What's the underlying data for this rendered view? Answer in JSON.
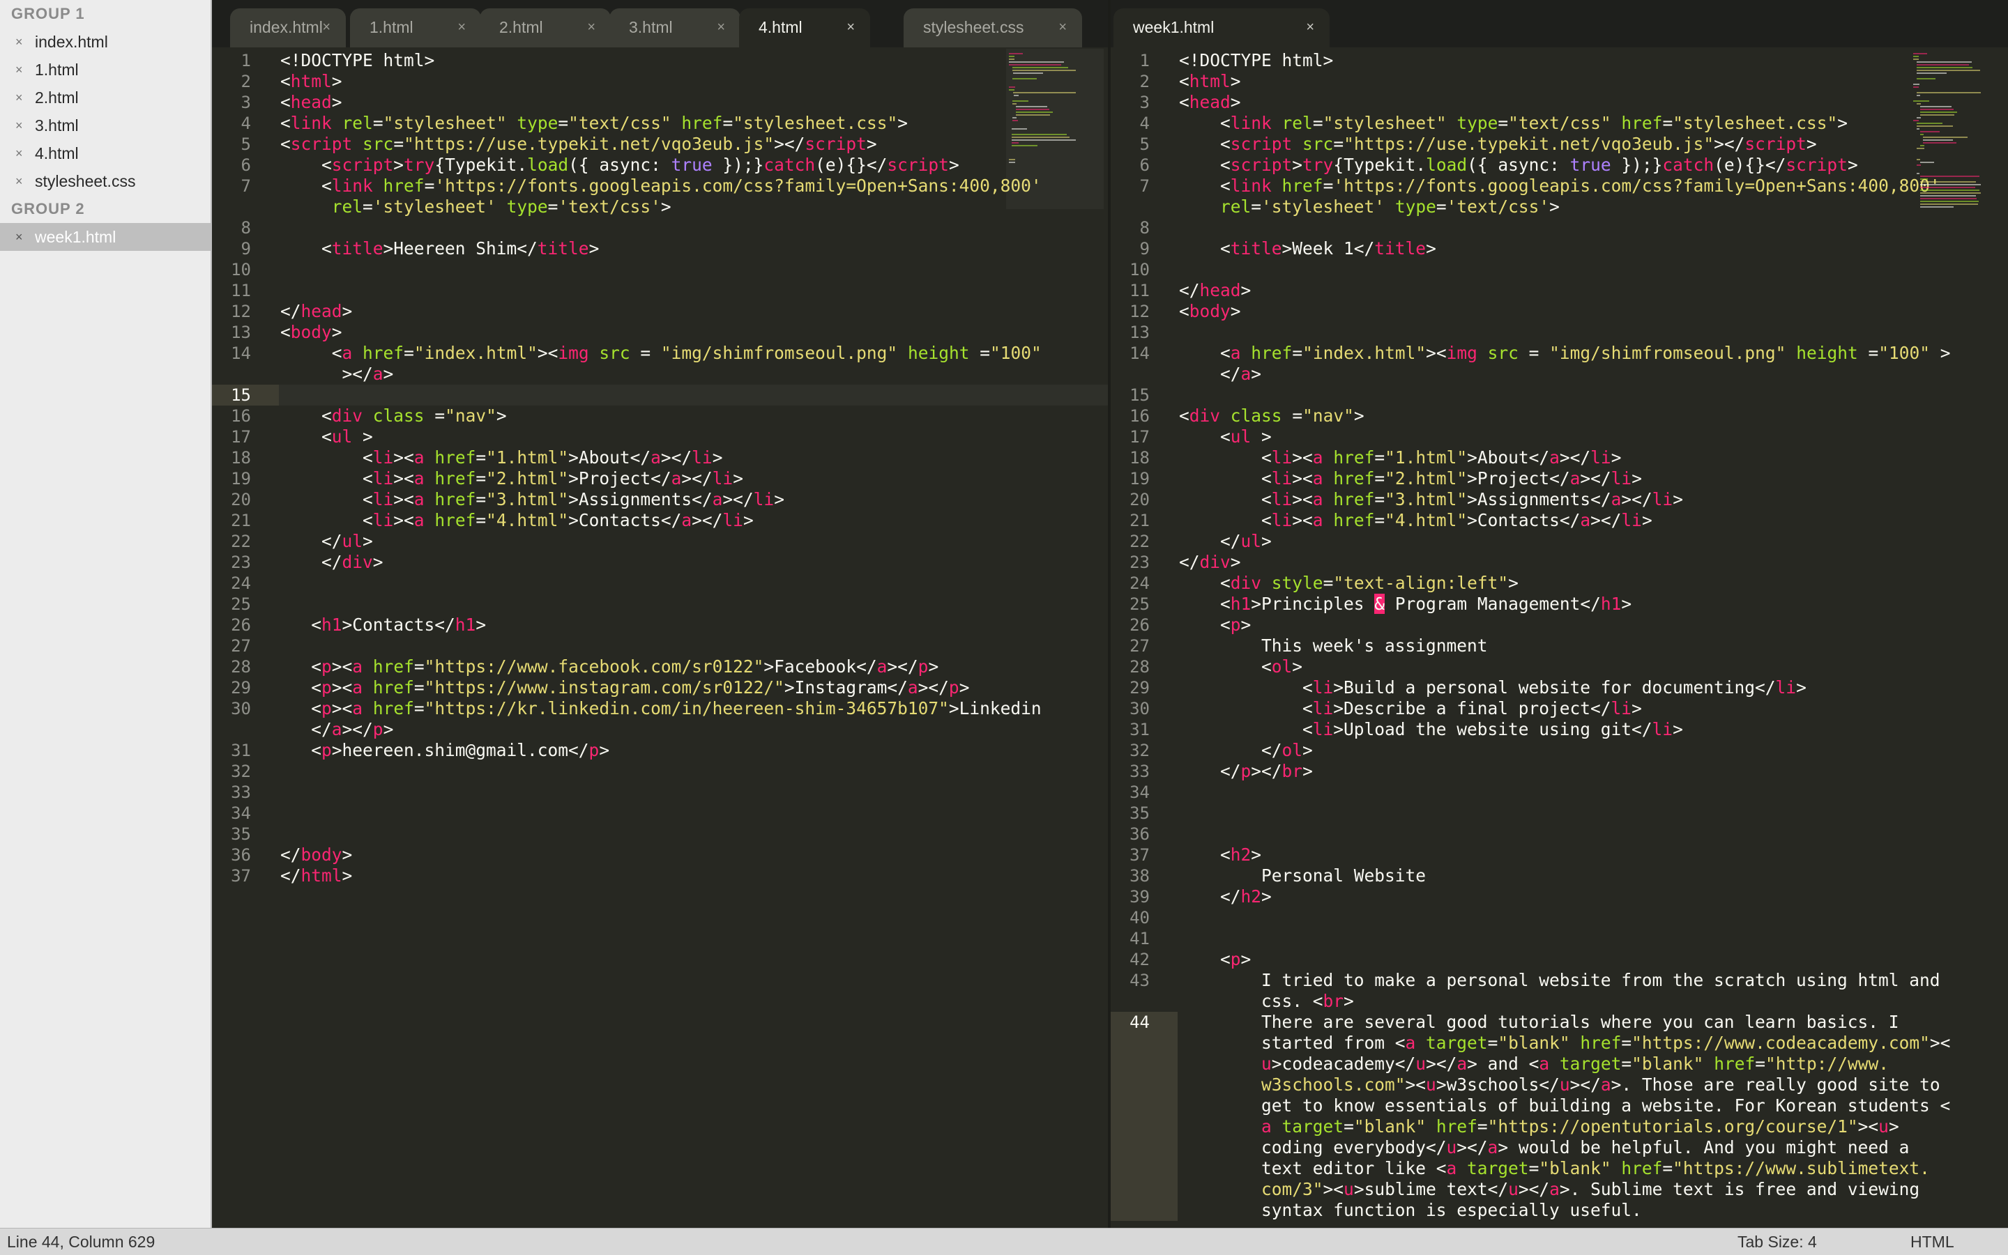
{
  "sidebar": {
    "groups": [
      {
        "title": "GROUP 1",
        "files": [
          "index.html",
          "1.html",
          "2.html",
          "3.html",
          "4.html",
          "stylesheet.css"
        ]
      },
      {
        "title": "GROUP 2",
        "files": [
          "week1.html"
        ]
      }
    ],
    "active_file": "week1.html",
    "close_glyph": "×"
  },
  "left_pane": {
    "tabs": [
      "index.html",
      "1.html",
      "2.html",
      "3.html",
      "4.html",
      "stylesheet.css"
    ],
    "active_tab": "4.html",
    "current_line": "15",
    "lines": [
      {
        "n": "1",
        "html": "&lt;!DOCTYPE html&gt;"
      },
      {
        "n": "2",
        "html": "&lt;<span class='t'>html</span>&gt;"
      },
      {
        "n": "3",
        "html": "&lt;<span class='t'>head</span>&gt;"
      },
      {
        "n": "4",
        "html": "&lt;<span class='t'>link</span> <span class='a'>rel</span>=<span class='s'>\"stylesheet\"</span> <span class='a'>type</span>=<span class='s'>\"text/css\"</span> <span class='a'>href</span>=<span class='s'>\"stylesheet.css\"</span>&gt;"
      },
      {
        "n": "5",
        "html": "&lt;<span class='t'>script</span> <span class='a'>src</span>=<span class='s'>\"https://use.typekit.net/vqo3eub.js\"</span>&gt;&lt;/<span class='t'>script</span>&gt;"
      },
      {
        "n": "6",
        "html": "    &lt;<span class='t'>script</span>&gt;<span class='t'>try</span>{Typekit.<span class='a'>load</span>({ async: <span class='kw'>true</span> });}<span class='t'>catch</span>(e){}&lt;/<span class='t'>script</span>&gt;"
      },
      {
        "n": "7",
        "html": "    &lt;<span class='t'>link</span> <span class='a'>href</span>=<span class='s'>'https://fonts.googleapis.com/css?family=Open+Sans:400,800'</span>"
      },
      {
        "n": "",
        "html": "     <span class='a'>rel</span>=<span class='s'>'stylesheet'</span> <span class='a'>type</span>=<span class='s'>'text/css'</span>&gt;"
      },
      {
        "n": "8",
        "html": ""
      },
      {
        "n": "9",
        "html": "    &lt;<span class='t'>title</span>&gt;Heereen Shim&lt;/<span class='t'>title</span>&gt;"
      },
      {
        "n": "10",
        "html": ""
      },
      {
        "n": "11",
        "html": ""
      },
      {
        "n": "12",
        "html": "&lt;/<span class='t'>head</span>&gt;"
      },
      {
        "n": "13",
        "html": "&lt;<span class='t'>body</span>&gt;"
      },
      {
        "n": "14",
        "html": "     &lt;<span class='t'>a</span> <span class='a'>href</span>=<span class='s'>\"index.html\"</span>&gt;&lt;<span class='t'>img</span> <span class='a'>src</span> = <span class='s'>\"img/shimfromseoul.png\"</span> <span class='a'>height</span> =<span class='s'>\"100\"</span>"
      },
      {
        "n": "",
        "html": "      &gt;&lt;/<span class='t'>a</span>&gt;"
      },
      {
        "n": "15",
        "html": ""
      },
      {
        "n": "16",
        "html": "    &lt;<span class='t'>div</span> <span class='a'>class</span> =<span class='s'>\"nav\"</span>&gt;"
      },
      {
        "n": "17",
        "html": "    &lt;<span class='t'>ul</span> &gt;"
      },
      {
        "n": "18",
        "html": "        &lt;<span class='t'>li</span>&gt;&lt;<span class='t'>a</span> <span class='a'>href</span>=<span class='s'>\"1.html\"</span>&gt;About&lt;/<span class='t'>a</span>&gt;&lt;/<span class='t'>li</span>&gt;"
      },
      {
        "n": "19",
        "html": "        &lt;<span class='t'>li</span>&gt;&lt;<span class='t'>a</span> <span class='a'>href</span>=<span class='s'>\"2.html\"</span>&gt;Project&lt;/<span class='t'>a</span>&gt;&lt;/<span class='t'>li</span>&gt;"
      },
      {
        "n": "20",
        "html": "        &lt;<span class='t'>li</span>&gt;&lt;<span class='t'>a</span> <span class='a'>href</span>=<span class='s'>\"3.html\"</span>&gt;Assignments&lt;/<span class='t'>a</span>&gt;&lt;/<span class='t'>li</span>&gt;"
      },
      {
        "n": "21",
        "html": "        &lt;<span class='t'>li</span>&gt;&lt;<span class='t'>a</span> <span class='a'>href</span>=<span class='s'>\"4.html\"</span>&gt;Contacts&lt;/<span class='t'>a</span>&gt;&lt;/<span class='t'>li</span>&gt;"
      },
      {
        "n": "22",
        "html": "    &lt;/<span class='t'>ul</span>&gt;"
      },
      {
        "n": "23",
        "html": "    &lt;/<span class='t'>div</span>&gt;"
      },
      {
        "n": "24",
        "html": ""
      },
      {
        "n": "25",
        "html": ""
      },
      {
        "n": "26",
        "html": "   &lt;<span class='t'>h1</span>&gt;Contacts&lt;/<span class='t'>h1</span>&gt;"
      },
      {
        "n": "27",
        "html": ""
      },
      {
        "n": "28",
        "html": "   &lt;<span class='t'>p</span>&gt;&lt;<span class='t'>a</span> <span class='a'>href</span>=<span class='s'>\"https://www.facebook.com/sr0122\"</span>&gt;Facebook&lt;/<span class='t'>a</span>&gt;&lt;/<span class='t'>p</span>&gt;"
      },
      {
        "n": "29",
        "html": "   &lt;<span class='t'>p</span>&gt;&lt;<span class='t'>a</span> <span class='a'>href</span>=<span class='s'>\"https://www.instagram.com/sr0122/\"</span>&gt;Instagram&lt;/<span class='t'>a</span>&gt;&lt;/<span class='t'>p</span>&gt;"
      },
      {
        "n": "30",
        "html": "   &lt;<span class='t'>p</span>&gt;&lt;<span class='t'>a</span> <span class='a'>href</span>=<span class='s'>\"https://kr.linkedin.com/in/heereen-shim-34657b107\"</span>&gt;Linkedin"
      },
      {
        "n": "",
        "html": "   &lt;/<span class='t'>a</span>&gt;&lt;/<span class='t'>p</span>&gt;"
      },
      {
        "n": "31",
        "html": "   &lt;<span class='t'>p</span>&gt;heereen.shim@gmail.com&lt;/<span class='t'>p</span>&gt;"
      },
      {
        "n": "32",
        "html": ""
      },
      {
        "n": "33",
        "html": ""
      },
      {
        "n": "34",
        "html": ""
      },
      {
        "n": "35",
        "html": ""
      },
      {
        "n": "36",
        "html": "&lt;/<span class='t'>body</span>&gt;"
      },
      {
        "n": "37",
        "html": "&lt;/<span class='t'>html</span>&gt;"
      }
    ]
  },
  "right_pane": {
    "tabs": [
      "week1.html"
    ],
    "active_tab": "week1.html",
    "current_line": "44",
    "lines": [
      {
        "n": "1",
        "html": "&lt;!DOCTYPE html&gt;"
      },
      {
        "n": "2",
        "html": "&lt;<span class='t'>html</span>&gt;"
      },
      {
        "n": "3",
        "html": "&lt;<span class='t'>head</span>&gt;"
      },
      {
        "n": "4",
        "html": "    &lt;<span class='t'>link</span> <span class='a'>rel</span>=<span class='s'>\"stylesheet\"</span> <span class='a'>type</span>=<span class='s'>\"text/css\"</span> <span class='a'>href</span>=<span class='s'>\"stylesheet.css\"</span>&gt;"
      },
      {
        "n": "5",
        "html": "    &lt;<span class='t'>script</span> <span class='a'>src</span>=<span class='s'>\"https://use.typekit.net/vqo3eub.js\"</span>&gt;&lt;/<span class='t'>script</span>&gt;"
      },
      {
        "n": "6",
        "html": "    &lt;<span class='t'>script</span>&gt;<span class='t'>try</span>{Typekit.<span class='a'>load</span>({ async: <span class='kw'>true</span> });}<span class='t'>catch</span>(e){}&lt;/<span class='t'>script</span>&gt;"
      },
      {
        "n": "7",
        "html": "    &lt;<span class='t'>link</span> <span class='a'>href</span>=<span class='s'>'https://fonts.googleapis.com/css?family=Open+Sans:400,800'</span>"
      },
      {
        "n": "",
        "html": "    <span class='a'>rel</span>=<span class='s'>'stylesheet'</span> <span class='a'>type</span>=<span class='s'>'text/css'</span>&gt;"
      },
      {
        "n": "8",
        "html": ""
      },
      {
        "n": "9",
        "html": "    &lt;<span class='t'>title</span>&gt;Week 1&lt;/<span class='t'>title</span>&gt;"
      },
      {
        "n": "10",
        "html": ""
      },
      {
        "n": "11",
        "html": "&lt;/<span class='t'>head</span>&gt;"
      },
      {
        "n": "12",
        "html": "&lt;<span class='t'>body</span>&gt;"
      },
      {
        "n": "13",
        "html": ""
      },
      {
        "n": "14",
        "html": "    &lt;<span class='t'>a</span> <span class='a'>href</span>=<span class='s'>\"index.html\"</span>&gt;&lt;<span class='t'>img</span> <span class='a'>src</span> = <span class='s'>\"img/shimfromseoul.png\"</span> <span class='a'>height</span> =<span class='s'>\"100\"</span> &gt;"
      },
      {
        "n": "",
        "html": "    &lt;/<span class='t'>a</span>&gt;"
      },
      {
        "n": "15",
        "html": ""
      },
      {
        "n": "16",
        "html": "&lt;<span class='t'>div</span> <span class='a'>class</span> =<span class='s'>\"nav\"</span>&gt;"
      },
      {
        "n": "17",
        "html": "    &lt;<span class='t'>ul</span> &gt;"
      },
      {
        "n": "18",
        "html": "        &lt;<span class='t'>li</span>&gt;&lt;<span class='t'>a</span> <span class='a'>href</span>=<span class='s'>\"1.html\"</span>&gt;About&lt;/<span class='t'>a</span>&gt;&lt;/<span class='t'>li</span>&gt;"
      },
      {
        "n": "19",
        "html": "        &lt;<span class='t'>li</span>&gt;&lt;<span class='t'>a</span> <span class='a'>href</span>=<span class='s'>\"2.html\"</span>&gt;Project&lt;/<span class='t'>a</span>&gt;&lt;/<span class='t'>li</span>&gt;"
      },
      {
        "n": "20",
        "html": "        &lt;<span class='t'>li</span>&gt;&lt;<span class='t'>a</span> <span class='a'>href</span>=<span class='s'>\"3.html\"</span>&gt;Assignments&lt;/<span class='t'>a</span>&gt;&lt;/<span class='t'>li</span>&gt;"
      },
      {
        "n": "21",
        "html": "        &lt;<span class='t'>li</span>&gt;&lt;<span class='t'>a</span> <span class='a'>href</span>=<span class='s'>\"4.html\"</span>&gt;Contacts&lt;/<span class='t'>a</span>&gt;&lt;/<span class='t'>li</span>&gt;"
      },
      {
        "n": "22",
        "html": "    &lt;/<span class='t'>ul</span>&gt;"
      },
      {
        "n": "23",
        "html": "&lt;/<span class='t'>div</span>&gt;"
      },
      {
        "n": "24",
        "html": "    &lt;<span class='t'>div</span> <span class='a'>style</span>=<span class='s'>\"text-align:left\"</span>&gt;"
      },
      {
        "n": "25",
        "html": "    &lt;<span class='t'>h1</span>&gt;Principles <span class='hlamp'>&amp;</span> Program Management&lt;/<span class='t'>h1</span>&gt;"
      },
      {
        "n": "26",
        "html": "    &lt;<span class='t'>p</span>&gt;"
      },
      {
        "n": "27",
        "html": "        This week's assignment"
      },
      {
        "n": "28",
        "html": "        &lt;<span class='t'>ol</span>&gt;"
      },
      {
        "n": "29",
        "html": "            &lt;<span class='t'>li</span>&gt;Build a personal website for documenting&lt;/<span class='t'>li</span>&gt;"
      },
      {
        "n": "30",
        "html": "            &lt;<span class='t'>li</span>&gt;Describe a final project&lt;/<span class='t'>li</span>&gt;"
      },
      {
        "n": "31",
        "html": "            &lt;<span class='t'>li</span>&gt;Upload the website using git&lt;/<span class='t'>li</span>&gt;"
      },
      {
        "n": "32",
        "html": "        &lt;/<span class='t'>ol</span>&gt;"
      },
      {
        "n": "33",
        "html": "    &lt;/<span class='t'>p</span>&gt;&lt;/<span class='t'>br</span>&gt;"
      },
      {
        "n": "34",
        "html": ""
      },
      {
        "n": "35",
        "html": ""
      },
      {
        "n": "36",
        "html": ""
      },
      {
        "n": "37",
        "html": "    &lt;<span class='t'>h2</span>&gt;"
      },
      {
        "n": "38",
        "html": "        Personal Website"
      },
      {
        "n": "39",
        "html": "    &lt;/<span class='t'>h2</span>&gt;"
      },
      {
        "n": "40",
        "html": ""
      },
      {
        "n": "41",
        "html": ""
      },
      {
        "n": "42",
        "html": "    &lt;<span class='t'>p</span>&gt;"
      },
      {
        "n": "43",
        "html": "        I tried to make a personal website from the scratch using html and"
      },
      {
        "n": "",
        "html": "        css. &lt;<span class='t'>br</span>&gt;"
      },
      {
        "n": "44",
        "html": "        There are several good tutorials where you can learn basics. I"
      },
      {
        "n": "",
        "html": "        started from &lt;<span class='t'>a</span> <span class='a'>target</span>=<span class='s'>\"blank\"</span> <span class='a'>href</span>=<span class='s'>\"https://www.codeacademy.com\"</span>&gt;&lt;"
      },
      {
        "n": "",
        "html": "        <span class='t'>u</span>&gt;codeacademy&lt;/<span class='t'>u</span>&gt;&lt;/<span class='t'>a</span>&gt; and &lt;<span class='t'>a</span> <span class='a'>target</span>=<span class='s'>\"blank\"</span> <span class='a'>href</span>=<span class='s'>\"http://www.</span>"
      },
      {
        "n": "",
        "html": "        <span class='s'>w3schools.com\"</span>&gt;&lt;<span class='t'>u</span>&gt;w3schools&lt;/<span class='t'>u</span>&gt;&lt;/<span class='t'>a</span>&gt;. Those are really good site to"
      },
      {
        "n": "",
        "html": "        get to know essentials of building a website. For Korean students &lt;"
      },
      {
        "n": "",
        "html": "        <span class='t'>a</span> <span class='a'>target</span>=<span class='s'>\"blank\"</span> <span class='a'>href</span>=<span class='s'>\"https://opentutorials.org/course/1\"</span>&gt;&lt;<span class='t'>u</span>&gt;"
      },
      {
        "n": "",
        "html": "        coding everybody&lt;/<span class='t'>u</span>&gt;&lt;/<span class='t'>a</span>&gt; would be helpful. And you might need a"
      },
      {
        "n": "",
        "html": "        text editor like &lt;<span class='t'>a</span> <span class='a'>target</span>=<span class='s'>\"blank\"</span> <span class='a'>href</span>=<span class='s'>\"https://www.sublimetext.</span>"
      },
      {
        "n": "",
        "html": "        <span class='s'>com/3\"</span>&gt;&lt;<span class='t'>u</span>&gt;sublime text&lt;/<span class='t'>u</span>&gt;&lt;/<span class='t'>a</span>&gt;. Sublime text is free and viewing"
      },
      {
        "n": "",
        "html": "        syntax function is especially useful."
      }
    ]
  },
  "statusbar": {
    "position": "Line 44, Column 629",
    "tab_size": "Tab Size: 4",
    "syntax": "HTML"
  },
  "colors": {
    "background": "#272822",
    "tag": "#f92672",
    "attribute": "#a6e22e",
    "string": "#e6db74",
    "constant": "#ae81ff",
    "text": "#f8f8f2"
  }
}
